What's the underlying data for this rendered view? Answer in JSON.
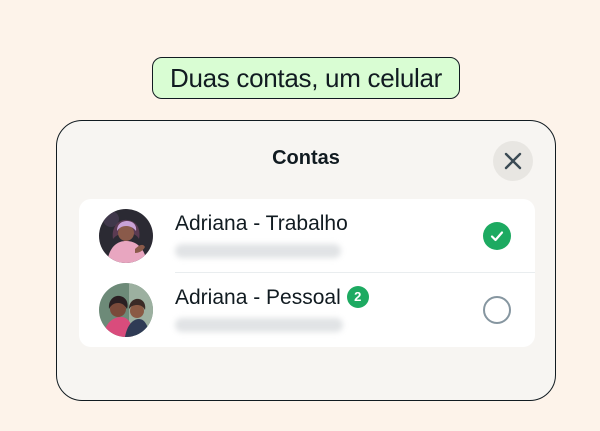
{
  "colors": {
    "background": "#fdf3ea",
    "headline_bg": "#d9fdd3",
    "sheet_bg": "#f7f5f2",
    "close_bg": "#e8e6e2",
    "accent_green": "#1daa61",
    "placeholder_gray": "#c8ccd0"
  },
  "headline": {
    "text": "Duas contas, um celular"
  },
  "sheet": {
    "title": "Contas",
    "close_icon": "close-icon"
  },
  "accounts": [
    {
      "name": "Adriana - Trabalho",
      "badge": "",
      "selected": true
    },
    {
      "name": "Adriana - Pessoal",
      "badge": "2",
      "selected": false
    }
  ]
}
